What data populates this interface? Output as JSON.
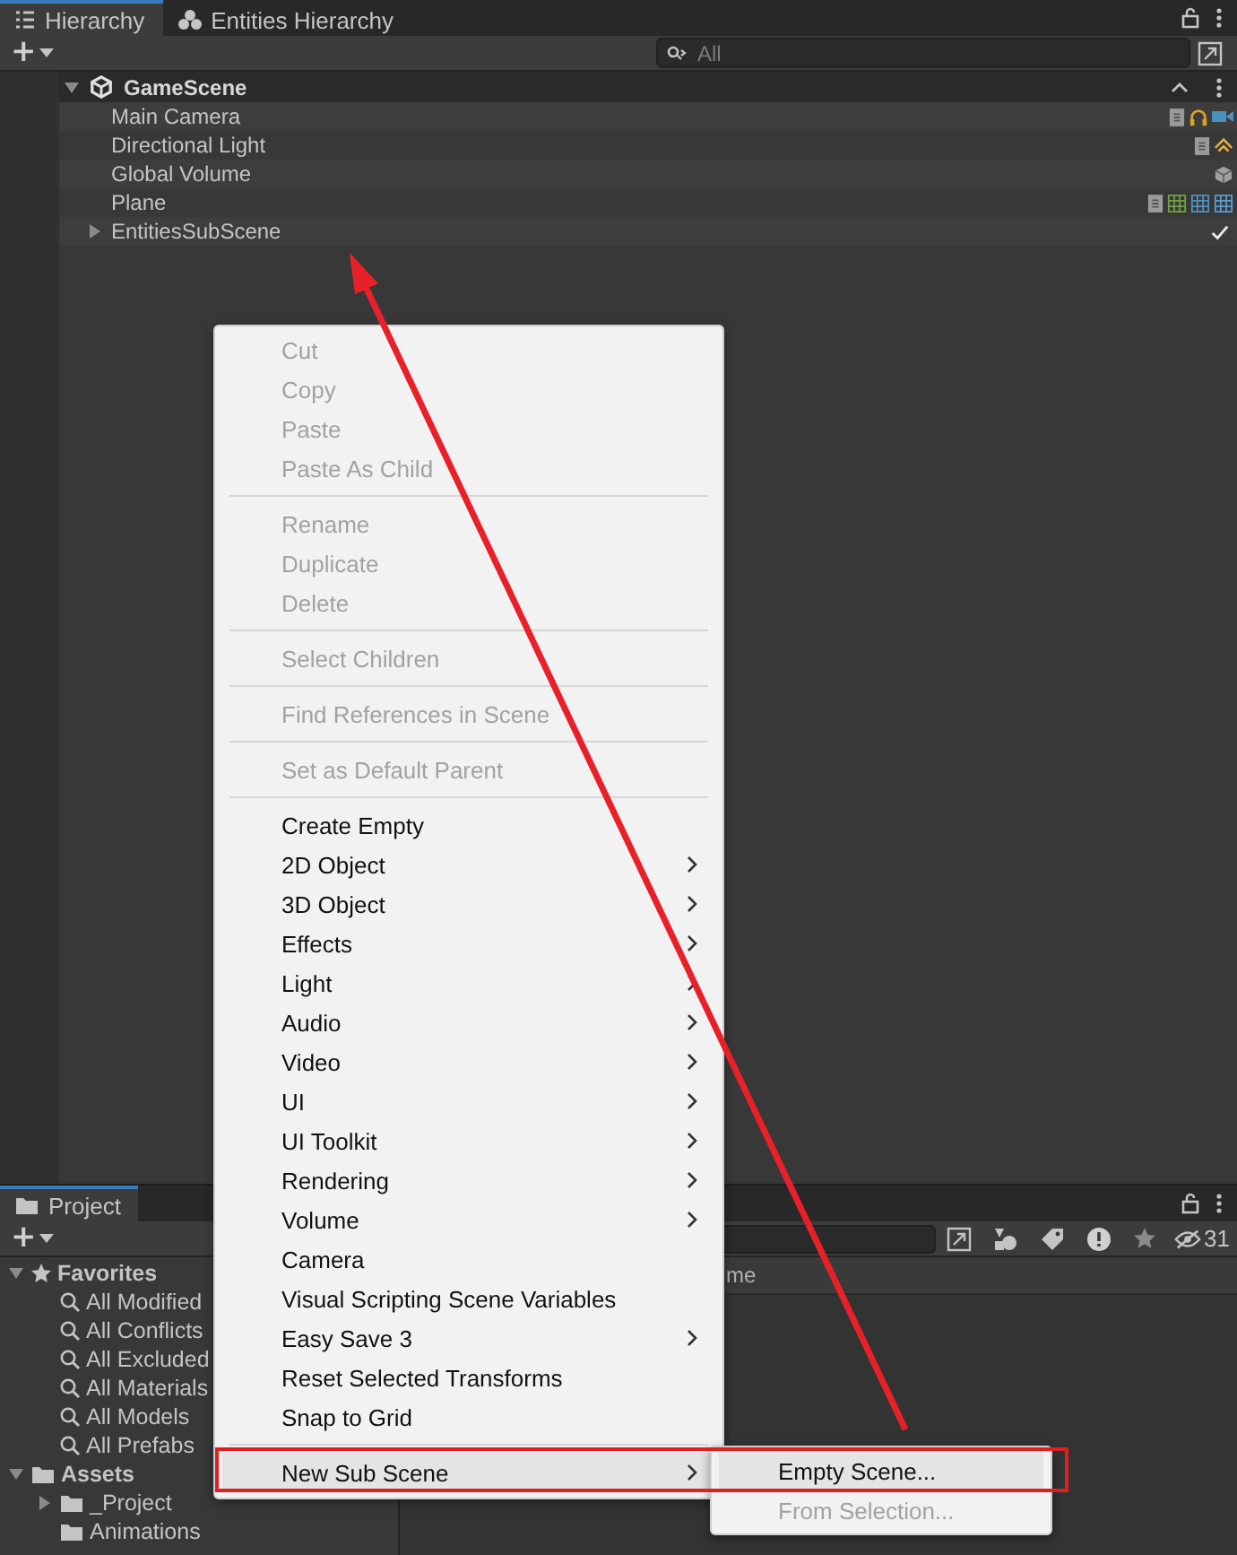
{
  "hierarchy_panel": {
    "tabs": [
      {
        "label": "Hierarchy",
        "selected": true
      },
      {
        "label": "Entities Hierarchy",
        "selected": false
      }
    ],
    "add_button": "+",
    "search": {
      "placeholder": "All"
    },
    "scene": {
      "name": "GameScene",
      "expanded": true
    },
    "objects": [
      {
        "kind": "object",
        "name": "Main Camera",
        "checked": false
      },
      {
        "kind": "object",
        "name": "Directional Light",
        "checked": false
      },
      {
        "kind": "object",
        "name": "Global Volume",
        "checked": false
      },
      {
        "kind": "object",
        "name": "Plane",
        "checked": false
      },
      {
        "kind": "subscene",
        "name": "EntitiesSubScene",
        "expanded": false,
        "checked": true
      }
    ]
  },
  "project_panel": {
    "tabs": [
      {
        "label": "Project",
        "selected": true
      }
    ],
    "add_button": "+",
    "hidden_count": "31",
    "column_heading": "me",
    "tree": [
      {
        "kind": "favorites",
        "label": "Favorites",
        "expanded": true,
        "children": [
          {
            "kind": "saved_search",
            "label": "All Modified"
          },
          {
            "kind": "saved_search",
            "label": "All Conflicts"
          },
          {
            "kind": "saved_search",
            "label": "All Excluded"
          },
          {
            "kind": "saved_search",
            "label": "All Materials"
          },
          {
            "kind": "saved_search",
            "label": "All Models"
          },
          {
            "kind": "saved_search",
            "label": "All Prefabs"
          }
        ]
      },
      {
        "kind": "folder",
        "label": "Assets",
        "expanded": true,
        "children": [
          {
            "kind": "folder",
            "label": "_Project",
            "expanded": false
          },
          {
            "kind": "folder",
            "label": "Animations"
          }
        ]
      }
    ]
  },
  "context_menu": {
    "items": [
      {
        "kind": "item",
        "label": "Cut",
        "disabled": true,
        "submenu": false,
        "selected": false
      },
      {
        "kind": "item",
        "label": "Copy",
        "disabled": true,
        "submenu": false,
        "selected": false
      },
      {
        "kind": "item",
        "label": "Paste",
        "disabled": true,
        "submenu": false,
        "selected": false
      },
      {
        "kind": "item",
        "label": "Paste As Child",
        "disabled": true,
        "submenu": false,
        "selected": false
      },
      {
        "kind": "separator"
      },
      {
        "kind": "item",
        "label": "Rename",
        "disabled": true,
        "submenu": false,
        "selected": false
      },
      {
        "kind": "item",
        "label": "Duplicate",
        "disabled": true,
        "submenu": false,
        "selected": false
      },
      {
        "kind": "item",
        "label": "Delete",
        "disabled": true,
        "submenu": false,
        "selected": false
      },
      {
        "kind": "separator"
      },
      {
        "kind": "item",
        "label": "Select Children",
        "disabled": true,
        "submenu": false,
        "selected": false
      },
      {
        "kind": "separator"
      },
      {
        "kind": "item",
        "label": "Find References in Scene",
        "disabled": true,
        "submenu": false,
        "selected": false
      },
      {
        "kind": "separator"
      },
      {
        "kind": "item",
        "label": "Set as Default Parent",
        "disabled": true,
        "submenu": false,
        "selected": false
      },
      {
        "kind": "separator"
      },
      {
        "kind": "item",
        "label": "Create Empty",
        "disabled": false,
        "submenu": false,
        "selected": false
      },
      {
        "kind": "item",
        "label": "2D Object",
        "disabled": false,
        "submenu": true,
        "selected": false
      },
      {
        "kind": "item",
        "label": "3D Object",
        "disabled": false,
        "submenu": true,
        "selected": false
      },
      {
        "kind": "item",
        "label": "Effects",
        "disabled": false,
        "submenu": true,
        "selected": false
      },
      {
        "kind": "item",
        "label": "Light",
        "disabled": false,
        "submenu": true,
        "selected": false
      },
      {
        "kind": "item",
        "label": "Audio",
        "disabled": false,
        "submenu": true,
        "selected": false
      },
      {
        "kind": "item",
        "label": "Video",
        "disabled": false,
        "submenu": true,
        "selected": false
      },
      {
        "kind": "item",
        "label": "UI",
        "disabled": false,
        "submenu": true,
        "selected": false
      },
      {
        "kind": "item",
        "label": "UI Toolkit",
        "disabled": false,
        "submenu": true,
        "selected": false
      },
      {
        "kind": "item",
        "label": "Rendering",
        "disabled": false,
        "submenu": true,
        "selected": false
      },
      {
        "kind": "item",
        "label": "Volume",
        "disabled": false,
        "submenu": true,
        "selected": false
      },
      {
        "kind": "item",
        "label": "Camera",
        "disabled": false,
        "submenu": false,
        "selected": false
      },
      {
        "kind": "item",
        "label": "Visual Scripting Scene Variables",
        "disabled": false,
        "submenu": false,
        "selected": false
      },
      {
        "kind": "item",
        "label": "Easy Save 3",
        "disabled": false,
        "submenu": true,
        "selected": false
      },
      {
        "kind": "item",
        "label": "Reset Selected Transforms",
        "disabled": false,
        "submenu": false,
        "selected": false
      },
      {
        "kind": "item",
        "label": "Snap to Grid",
        "disabled": false,
        "submenu": false,
        "selected": false
      },
      {
        "kind": "separator"
      },
      {
        "kind": "item",
        "label": "New Sub Scene",
        "disabled": false,
        "submenu": true,
        "selected": true
      }
    ]
  },
  "submenu": {
    "items": [
      {
        "kind": "item",
        "label": "Empty Scene...",
        "disabled": false,
        "submenu": false,
        "selected": true
      },
      {
        "kind": "item",
        "label": "From Selection...",
        "disabled": true,
        "submenu": false,
        "selected": false
      }
    ]
  }
}
